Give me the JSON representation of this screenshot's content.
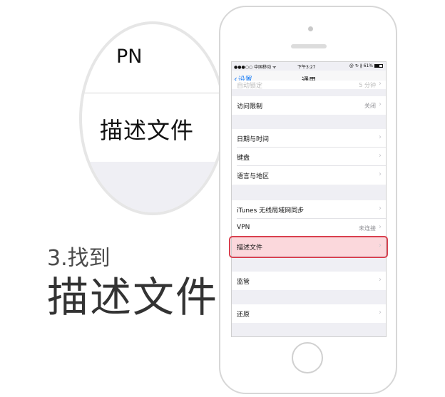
{
  "caption": {
    "step": "3.找到",
    "title": "描述文件"
  },
  "magnifier": {
    "partial_text": "PN",
    "focus_text": "描述文件"
  },
  "status_bar": {
    "carrier": "●●●○○ 中国移动 ᯤ",
    "time": "下午3:27",
    "right": "@ ↻ ∦ 61%"
  },
  "nav": {
    "back_label": "设置",
    "title": "通用"
  },
  "cells": {
    "auto_lock": {
      "label": "自动锁定",
      "value": "5 分钟"
    },
    "restrictions": {
      "label": "访问限制",
      "value": "关闭"
    },
    "date_time": {
      "label": "日期与时间"
    },
    "keyboard": {
      "label": "键盘"
    },
    "language_region": {
      "label": "语言与地区"
    },
    "itunes_wifi_sync": {
      "label": "iTunes 无线局域网同步"
    },
    "vpn": {
      "label": "VPN",
      "value": "未连接"
    },
    "profiles": {
      "label": "描述文件"
    },
    "supervision": {
      "label": "监管"
    },
    "reset": {
      "label": "还原"
    }
  },
  "colors": {
    "accent": "#1a7cf5",
    "highlight_border": "#d9404f",
    "highlight_fill": "#fbd8dc"
  }
}
